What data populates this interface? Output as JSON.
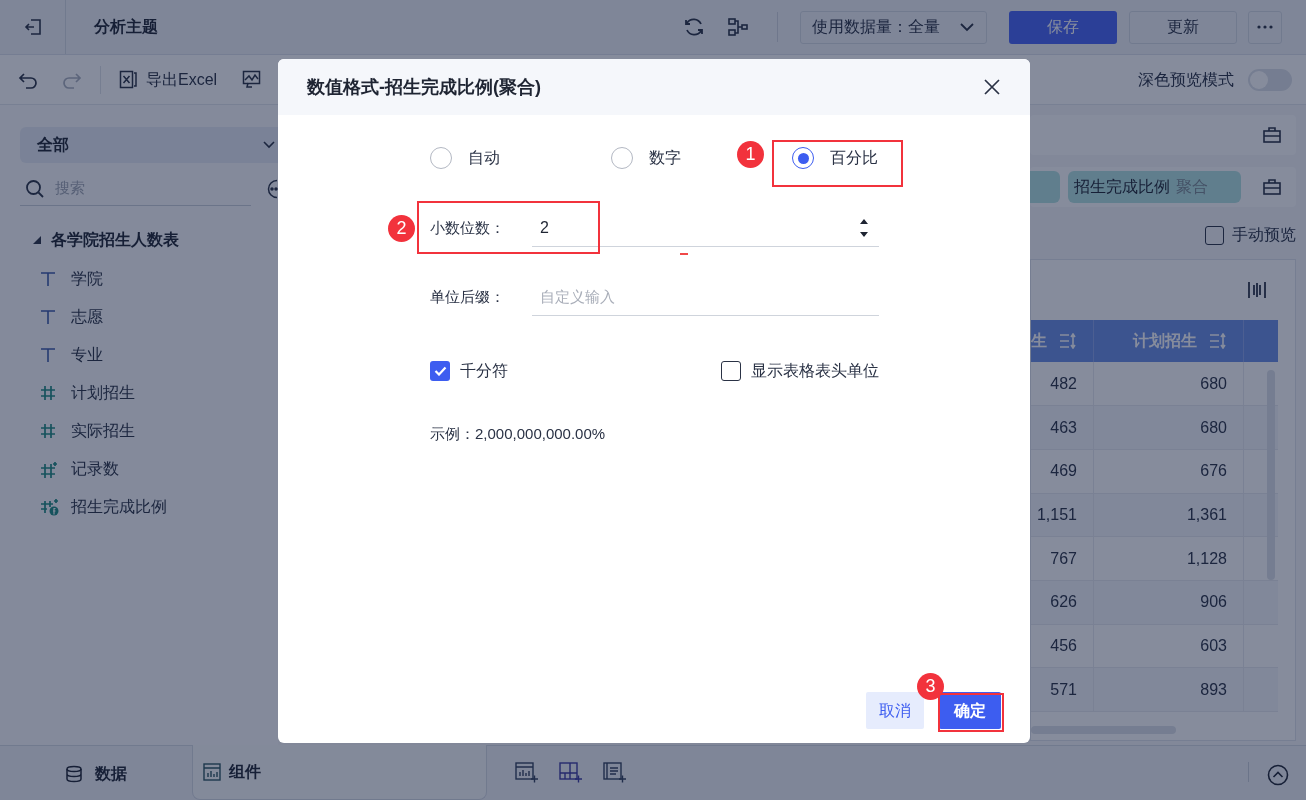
{
  "top_bar": {
    "title": "分析主题",
    "data_amount": "使用数据量：全量",
    "buttons": [
      {
        "label": "保存",
        "kind": "primary"
      },
      {
        "label": "更新",
        "kind": "secondary"
      }
    ]
  },
  "toolbar": {
    "export": "导出Excel",
    "dark_preview": {
      "label": "深色预览模式",
      "on": false
    }
  },
  "sidebar": {
    "dropdown": "全部",
    "search": {
      "placeholder": "搜索"
    },
    "tree": [
      {
        "label": "各学院招生人数表",
        "expanded": true,
        "children": [
          {
            "label": "学院",
            "kind": "text"
          },
          {
            "label": "志愿",
            "kind": "text"
          },
          {
            "label": "专业",
            "kind": "text"
          },
          {
            "label": "计划招生",
            "kind": "number"
          },
          {
            "label": "实际招生",
            "kind": "number"
          },
          {
            "label": "记录数",
            "kind": "count"
          },
          {
            "label": "招生完成比例",
            "kind": "calc"
          }
        ]
      }
    ]
  },
  "fields_panel": {
    "pills": [
      {
        "label": "招生完成比例",
        "tag": "聚合"
      }
    ]
  },
  "manual_preview": {
    "label": "手动预览",
    "checked": false
  },
  "table": {
    "columns": [
      "生",
      "计划招生"
    ],
    "rows": [
      [
        "482",
        "680"
      ],
      [
        "463",
        "680"
      ],
      [
        "469",
        "676"
      ],
      [
        "1,151",
        "1,361"
      ],
      [
        "767",
        "1,128"
      ],
      [
        "626",
        "906"
      ],
      [
        "456",
        "603"
      ],
      [
        "571",
        "893"
      ]
    ]
  },
  "bottom_bar": {
    "tabs": [
      {
        "label": "数据",
        "selected": false
      },
      {
        "label": "组件",
        "selected": true
      }
    ]
  },
  "dialog": {
    "title": "数值格式-招生完成比例(聚合)",
    "format_options": [
      {
        "label": "自动",
        "selected": false
      },
      {
        "label": "数字",
        "selected": false
      },
      {
        "label": "百分比",
        "selected": true
      }
    ],
    "decimal_places": {
      "label": "小数位数：",
      "value": "2"
    },
    "unit_suffix": {
      "label": "单位后缀：",
      "placeholder": "自定义输入"
    },
    "options": [
      {
        "label": "千分符",
        "checked": true
      },
      {
        "label": "显示表格表头单位",
        "checked": false
      }
    ],
    "example": "示例：2,000,000,000.00%",
    "buttons": [
      {
        "label": "取消",
        "kind": "secondary"
      },
      {
        "label": "确定",
        "kind": "primary"
      }
    ]
  },
  "annotations": [
    "1",
    "2",
    "3"
  ]
}
